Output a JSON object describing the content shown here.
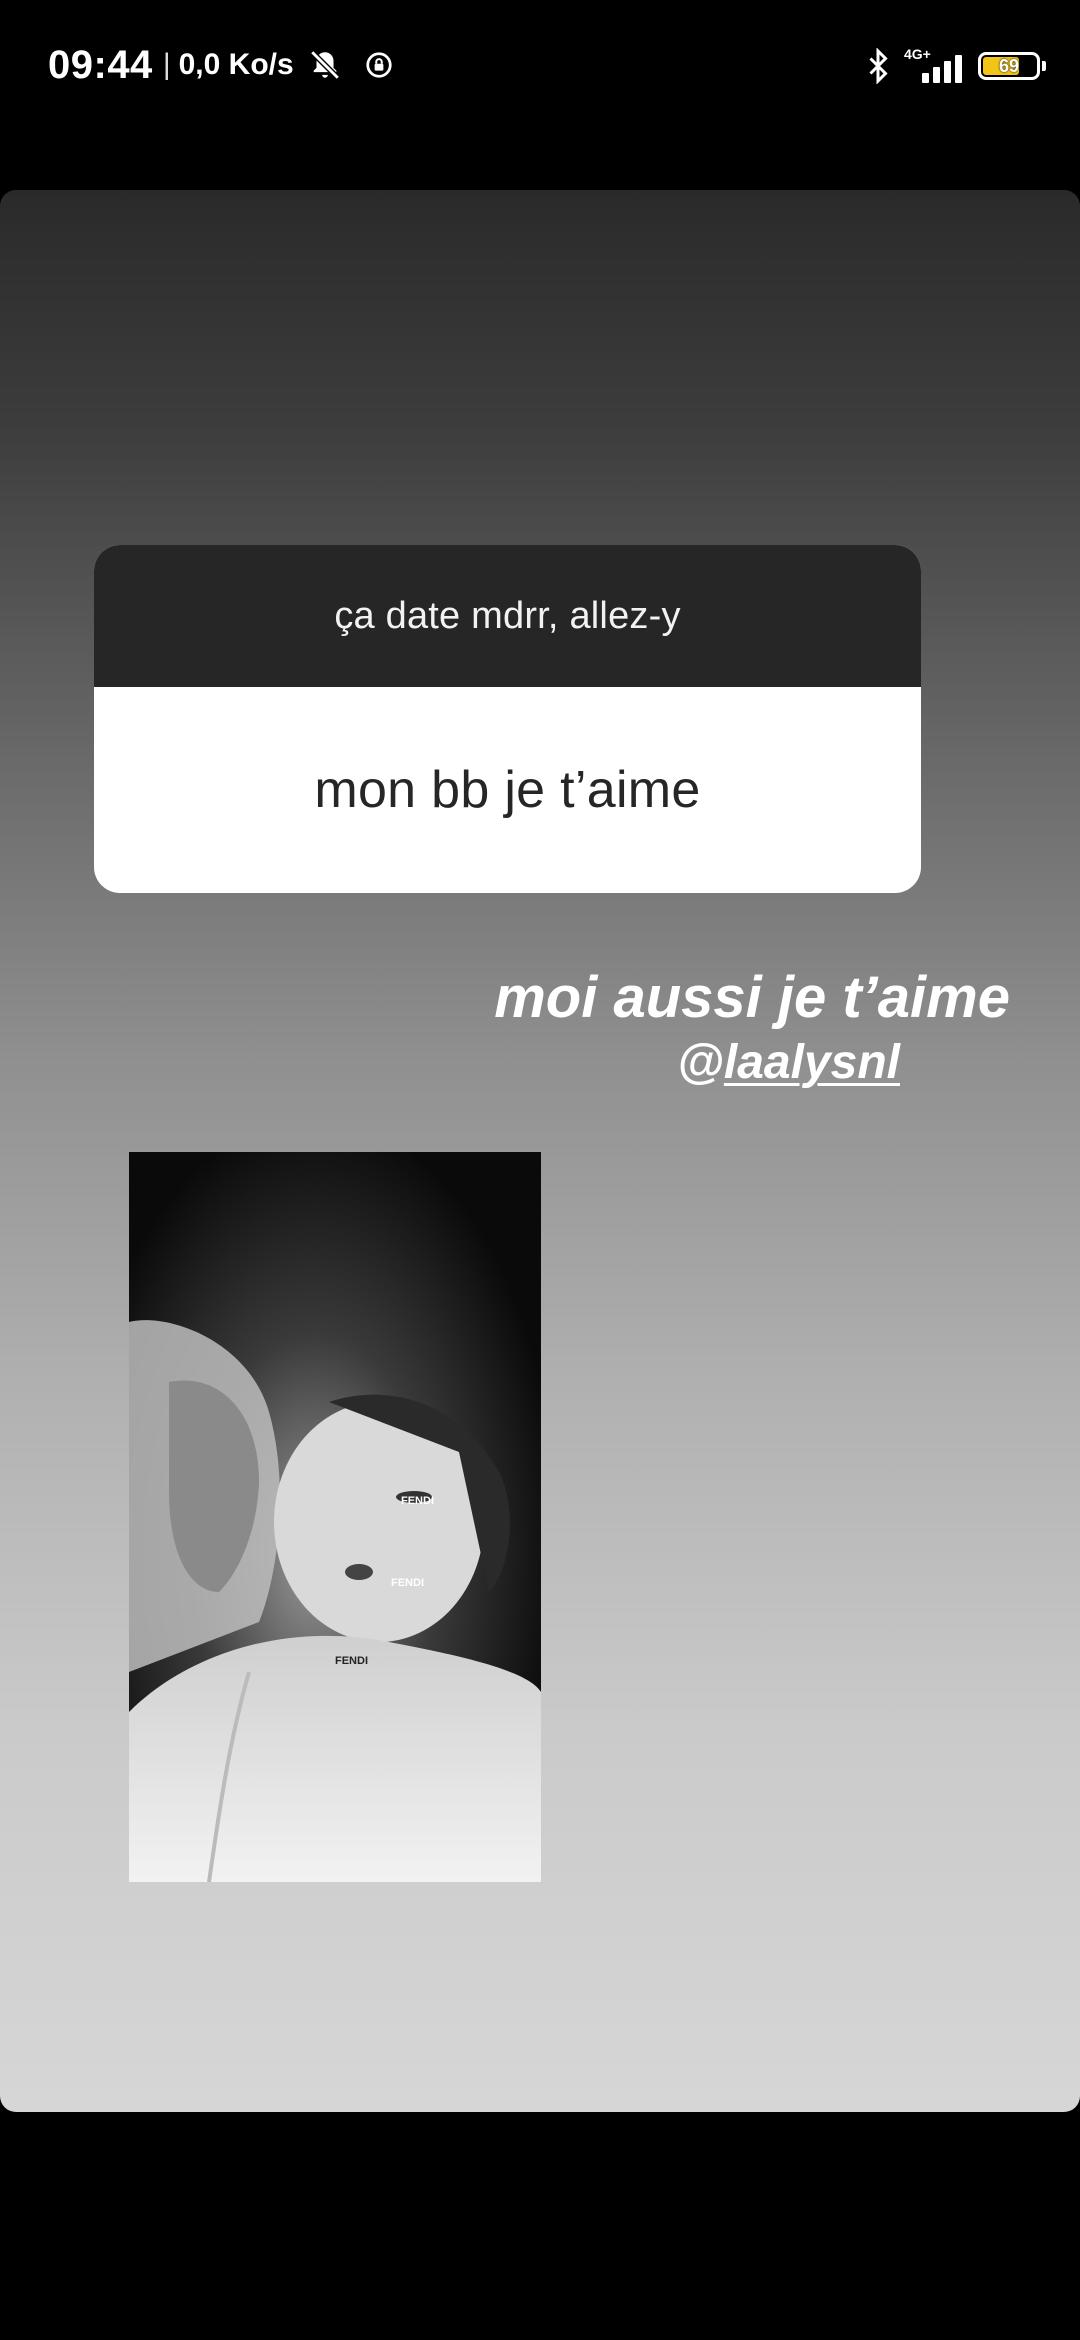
{
  "status_bar": {
    "time": "09:44",
    "separator": "|",
    "network_speed": "0,0 Ko/s",
    "network_type": "4G+",
    "battery_level": "69",
    "battery_fraction": 0.69,
    "icons": [
      "bell-off-icon",
      "rotation-lock-icon",
      "bluetooth-icon",
      "signal-icon",
      "battery-icon"
    ]
  },
  "story": {
    "question_sticker": {
      "prompt": "ça date mdrr, allez-y",
      "answer": "mon bb je t’aime"
    },
    "caption": {
      "text": "moi aussi je t’aime",
      "mention_prefix": "@",
      "mention_user": "laalysnl"
    },
    "photo": {
      "description_icon": "photo-icon",
      "labels": [
        "FENDI",
        "FENDI",
        "FENDI"
      ]
    }
  },
  "colors": {
    "sticker_header": "#262626",
    "battery": "#f2c417"
  }
}
